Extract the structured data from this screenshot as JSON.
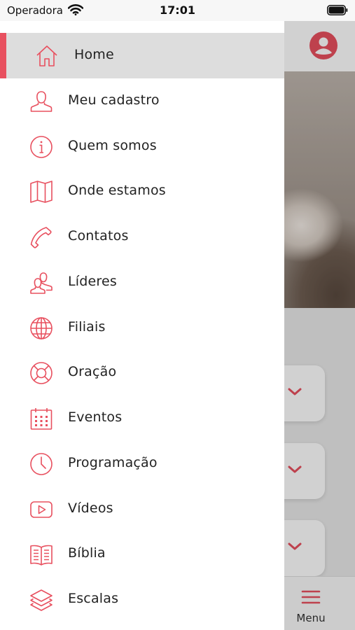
{
  "status_bar": {
    "carrier": "Operadora",
    "time": "17:01"
  },
  "colors": {
    "accent": "#e8505f",
    "drawer_bg": "#ffffff",
    "active_bg": "#dddddd"
  },
  "drawer": {
    "items": [
      {
        "label": "Home",
        "icon": "home-icon",
        "active": true
      },
      {
        "label": "Meu cadastro",
        "icon": "user-icon"
      },
      {
        "label": "Quem somos",
        "icon": "info-icon"
      },
      {
        "label": "Onde estamos",
        "icon": "map-icon"
      },
      {
        "label": "Contatos",
        "icon": "phone-icon"
      },
      {
        "label": "Líderes",
        "icon": "users-icon"
      },
      {
        "label": "Filiais",
        "icon": "globe-icon"
      },
      {
        "label": "Oração",
        "icon": "lifebuoy-icon"
      },
      {
        "label": "Eventos",
        "icon": "calendar-icon"
      },
      {
        "label": "Programação",
        "icon": "clock-icon"
      },
      {
        "label": "Vídeos",
        "icon": "video-icon"
      },
      {
        "label": "Bíblia",
        "icon": "book-icon"
      },
      {
        "label": "Escalas",
        "icon": "layers-icon"
      }
    ]
  },
  "tab_bar": {
    "menu_label": "Menu"
  }
}
